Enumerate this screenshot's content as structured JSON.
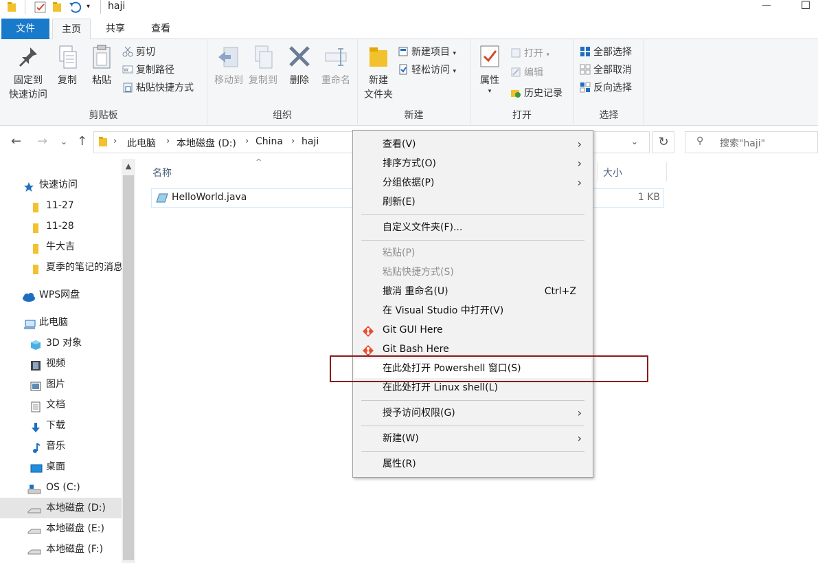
{
  "window": {
    "title": "haji",
    "minimize": "—",
    "maximize": "☐"
  },
  "tabs": [
    {
      "label": "文件"
    },
    {
      "label": "主页"
    },
    {
      "label": "共享"
    },
    {
      "label": "查看"
    }
  ],
  "ribbon": {
    "clipboard": {
      "label": "剪贴板",
      "pin": "固定到\n快速访问",
      "pin_l1": "固定到",
      "pin_l2": "快速访问",
      "copy": "复制",
      "paste": "粘贴",
      "cut": "剪切",
      "copy_path": "复制路径",
      "paste_shortcut": "粘贴快捷方式"
    },
    "organize": {
      "label": "组织",
      "move_to": "移动到",
      "copy_to": "复制到",
      "delete": "删除",
      "rename": "重命名"
    },
    "new": {
      "label": "新建",
      "new_folder_l1": "新建",
      "new_folder_l2": "文件夹",
      "new_item": "新建项目",
      "easy_access": "轻松访问"
    },
    "open": {
      "label": "打开",
      "properties": "属性",
      "open": "打开",
      "edit": "编辑",
      "history": "历史记录"
    },
    "select": {
      "label": "选择",
      "select_all": "全部选择",
      "select_none": "全部取消",
      "invert": "反向选择"
    }
  },
  "address": {
    "crumbs": [
      "此电脑",
      "本地磁盘 (D:)",
      "China",
      "haji"
    ],
    "search_placeholder": "搜索\"haji\""
  },
  "nav": {
    "items": [
      {
        "label": "快速访问",
        "icon": "star-icon"
      },
      {
        "label": "11-27",
        "icon": "folder-icon"
      },
      {
        "label": "11-28",
        "icon": "folder-icon"
      },
      {
        "label": "牛大吉",
        "icon": "folder-icon"
      },
      {
        "label": "夏季的笔记的消息",
        "icon": "folder-icon"
      },
      {
        "label": "WPS网盘",
        "icon": "cloud-icon"
      },
      {
        "label": "此电脑",
        "icon": "computer-icon"
      },
      {
        "label": "3D 对象",
        "icon": "cube-icon"
      },
      {
        "label": "视频",
        "icon": "video-icon"
      },
      {
        "label": "图片",
        "icon": "picture-icon"
      },
      {
        "label": "文档",
        "icon": "document-icon"
      },
      {
        "label": "下载",
        "icon": "download-icon"
      },
      {
        "label": "音乐",
        "icon": "music-icon"
      },
      {
        "label": "桌面",
        "icon": "desktop-icon"
      },
      {
        "label": "OS (C:)",
        "icon": "os-drive-icon"
      },
      {
        "label": "本地磁盘 (D:)",
        "icon": "drive-icon"
      },
      {
        "label": "本地磁盘 (E:)",
        "icon": "drive-icon"
      },
      {
        "label": "本地磁盘 (F:)",
        "icon": "drive-icon"
      }
    ]
  },
  "columns": {
    "name": "名称",
    "size": "大小"
  },
  "files": [
    {
      "name": "HelloWorld.java",
      "size": "1 KB"
    }
  ],
  "context_menu": {
    "view": "查看(V)",
    "sort": "排序方式(O)",
    "group": "分组依据(P)",
    "refresh": "刷新(E)",
    "customize": "自定义文件夹(F)...",
    "paste": "粘贴(P)",
    "paste_shortcut": "粘贴快捷方式(S)",
    "undo": "撤消 重命名(U)",
    "undo_shortcut": "Ctrl+Z",
    "open_vs": "在 Visual Studio 中打开(V)",
    "git_gui": "Git GUI Here",
    "git_bash": "Git Bash Here",
    "powershell": "在此处打开 Powershell 窗口(S)",
    "linux_shell": "在此处打开 Linux shell(L)",
    "grant_access": "授予访问权限(G)",
    "new": "新建(W)",
    "properties": "属性(R)"
  },
  "colors": {
    "accent": "#1979ca",
    "highlight_box": "#8b1a1a"
  }
}
